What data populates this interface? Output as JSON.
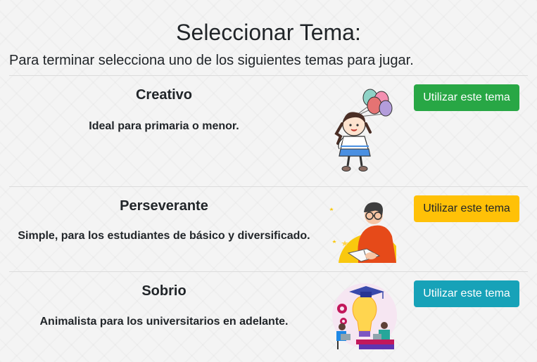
{
  "header": {
    "title": "Seleccionar Tema:",
    "subtitle": "Para terminar selecciona uno de los siguientes temas para jugar."
  },
  "themes": [
    {
      "name": "Creativo",
      "description": "Ideal para primaria o menor.",
      "button_label": "Utilizar este tema",
      "button_color": "#28a745",
      "illustration": "girl-with-balloons-icon"
    },
    {
      "name": "Perseverante",
      "description": "Simple, para los estudiantes de básico y diversificado.",
      "button_label": "Utilizar este tema",
      "button_color": "#ffc107",
      "illustration": "student-reading-icon"
    },
    {
      "name": "Sobrio",
      "description": "Animalista para los universitarios en adelante.",
      "button_label": "Utilizar este tema",
      "button_color": "#17a2b8",
      "illustration": "lightbulb-graduates-icon"
    }
  ]
}
